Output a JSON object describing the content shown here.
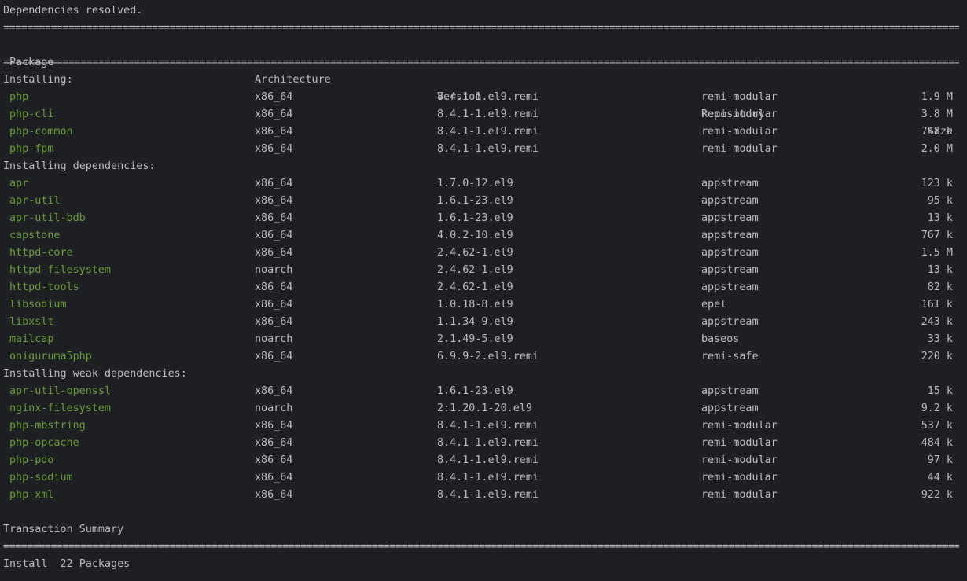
{
  "status_line": "Dependencies resolved.",
  "separator": "=================================================================================================================================================================================================",
  "header": {
    "package": "Package",
    "architecture": "Architecture",
    "version": "Version",
    "repository": "Repository",
    "size": "Size"
  },
  "sections": [
    {
      "title": "Installing:",
      "rows": [
        {
          "name": "php",
          "arch": "x86_64",
          "version": "8.4.1-1.el9.remi",
          "repo": "remi-modular",
          "size": "1.9 M"
        },
        {
          "name": "php-cli",
          "arch": "x86_64",
          "version": "8.4.1-1.el9.remi",
          "repo": "remi-modular",
          "size": "3.8 M"
        },
        {
          "name": "php-common",
          "arch": "x86_64",
          "version": "8.4.1-1.el9.remi",
          "repo": "remi-modular",
          "size": "748 k"
        },
        {
          "name": "php-fpm",
          "arch": "x86_64",
          "version": "8.4.1-1.el9.remi",
          "repo": "remi-modular",
          "size": "2.0 M"
        }
      ]
    },
    {
      "title": "Installing dependencies:",
      "rows": [
        {
          "name": "apr",
          "arch": "x86_64",
          "version": "1.7.0-12.el9",
          "repo": "appstream",
          "size": "123 k"
        },
        {
          "name": "apr-util",
          "arch": "x86_64",
          "version": "1.6.1-23.el9",
          "repo": "appstream",
          "size": "95 k"
        },
        {
          "name": "apr-util-bdb",
          "arch": "x86_64",
          "version": "1.6.1-23.el9",
          "repo": "appstream",
          "size": "13 k"
        },
        {
          "name": "capstone",
          "arch": "x86_64",
          "version": "4.0.2-10.el9",
          "repo": "appstream",
          "size": "767 k"
        },
        {
          "name": "httpd-core",
          "arch": "x86_64",
          "version": "2.4.62-1.el9",
          "repo": "appstream",
          "size": "1.5 M"
        },
        {
          "name": "httpd-filesystem",
          "arch": "noarch",
          "version": "2.4.62-1.el9",
          "repo": "appstream",
          "size": "13 k"
        },
        {
          "name": "httpd-tools",
          "arch": "x86_64",
          "version": "2.4.62-1.el9",
          "repo": "appstream",
          "size": "82 k"
        },
        {
          "name": "libsodium",
          "arch": "x86_64",
          "version": "1.0.18-8.el9",
          "repo": "epel",
          "size": "161 k"
        },
        {
          "name": "libxslt",
          "arch": "x86_64",
          "version": "1.1.34-9.el9",
          "repo": "appstream",
          "size": "243 k"
        },
        {
          "name": "mailcap",
          "arch": "noarch",
          "version": "2.1.49-5.el9",
          "repo": "baseos",
          "size": "33 k"
        },
        {
          "name": "oniguruma5php",
          "arch": "x86_64",
          "version": "6.9.9-2.el9.remi",
          "repo": "remi-safe",
          "size": "220 k"
        }
      ]
    },
    {
      "title": "Installing weak dependencies:",
      "rows": [
        {
          "name": "apr-util-openssl",
          "arch": "x86_64",
          "version": "1.6.1-23.el9",
          "repo": "appstream",
          "size": "15 k"
        },
        {
          "name": "nginx-filesystem",
          "arch": "noarch",
          "version": "2:1.20.1-20.el9",
          "repo": "appstream",
          "size": "9.2 k"
        },
        {
          "name": "php-mbstring",
          "arch": "x86_64",
          "version": "8.4.1-1.el9.remi",
          "repo": "remi-modular",
          "size": "537 k"
        },
        {
          "name": "php-opcache",
          "arch": "x86_64",
          "version": "8.4.1-1.el9.remi",
          "repo": "remi-modular",
          "size": "484 k"
        },
        {
          "name": "php-pdo",
          "arch": "x86_64",
          "version": "8.4.1-1.el9.remi",
          "repo": "remi-modular",
          "size": "97 k"
        },
        {
          "name": "php-sodium",
          "arch": "x86_64",
          "version": "8.4.1-1.el9.remi",
          "repo": "remi-modular",
          "size": "44 k"
        },
        {
          "name": "php-xml",
          "arch": "x86_64",
          "version": "8.4.1-1.el9.remi",
          "repo": "remi-modular",
          "size": "922 k"
        }
      ]
    }
  ],
  "summary": {
    "title": "Transaction Summary",
    "install_line": "Install  22 Packages"
  },
  "colors": {
    "background": "#1e1f22",
    "text": "#bcbec4",
    "package_name": "#6a9e3c"
  }
}
